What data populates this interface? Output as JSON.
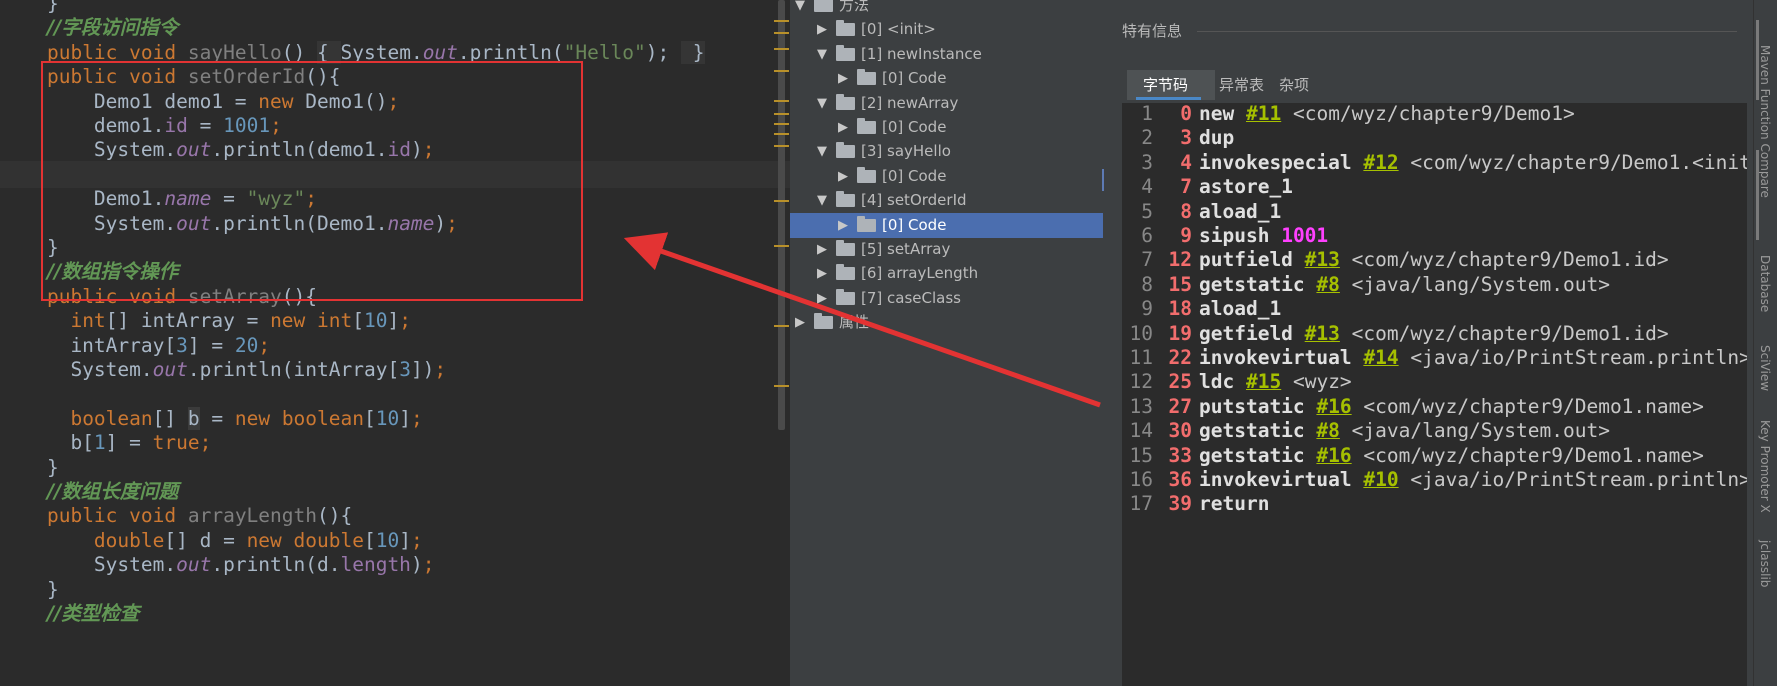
{
  "editor": {
    "lines": [
      {
        "segs": [
          {
            "t": "    }",
            "c": ""
          }
        ]
      },
      {
        "segs": [
          {
            "t": "    ",
            "c": ""
          },
          {
            "t": "//字段访问指令",
            "c": "cm"
          }
        ]
      },
      {
        "segs": [
          {
            "t": "    ",
            "c": ""
          },
          {
            "t": "public void ",
            "c": "k"
          },
          {
            "t": "sayHello",
            "c": "mg"
          },
          {
            "t": "() ",
            "c": ""
          },
          {
            "t": "{ ",
            "c": "fold"
          },
          {
            "t": "System.",
            "c": ""
          },
          {
            "t": "out",
            "c": "fd it"
          },
          {
            "t": ".println(",
            "c": ""
          },
          {
            "t": "\"Hello\"",
            "c": "st"
          },
          {
            "t": "); ",
            "c": ""
          },
          {
            "t": " }",
            "c": "fold"
          }
        ]
      },
      {
        "segs": [
          {
            "t": "    ",
            "c": ""
          },
          {
            "t": "public void ",
            "c": "k"
          },
          {
            "t": "setOrderId",
            "c": "mg"
          },
          {
            "t": "(){",
            "c": ""
          }
        ]
      },
      {
        "segs": [
          {
            "t": "        Demo1 demo1 = ",
            "c": ""
          },
          {
            "t": "new ",
            "c": "k"
          },
          {
            "t": "Demo1()",
            "c": ""
          },
          {
            "t": ";",
            "c": "k"
          }
        ]
      },
      {
        "segs": [
          {
            "t": "        demo1.",
            "c": ""
          },
          {
            "t": "id",
            "c": "fd"
          },
          {
            "t": " = ",
            "c": ""
          },
          {
            "t": "1001",
            "c": "nm"
          },
          {
            "t": ";",
            "c": "k"
          }
        ]
      },
      {
        "segs": [
          {
            "t": "        System.",
            "c": ""
          },
          {
            "t": "out",
            "c": "fd it"
          },
          {
            "t": ".println(demo1.",
            "c": ""
          },
          {
            "t": "id",
            "c": "fd"
          },
          {
            "t": ")",
            "c": ""
          },
          {
            "t": ";",
            "c": "k"
          }
        ]
      },
      {
        "segs": [
          {
            "t": "",
            "c": ""
          }
        ],
        "hl": true
      },
      {
        "segs": [
          {
            "t": "        Demo1.",
            "c": ""
          },
          {
            "t": "name",
            "c": "fd it"
          },
          {
            "t": " = ",
            "c": ""
          },
          {
            "t": "\"wyz\"",
            "c": "st"
          },
          {
            "t": ";",
            "c": "k"
          }
        ]
      },
      {
        "segs": [
          {
            "t": "        System.",
            "c": ""
          },
          {
            "t": "out",
            "c": "fd it"
          },
          {
            "t": ".println(Demo1.",
            "c": ""
          },
          {
            "t": "name",
            "c": "fd it"
          },
          {
            "t": ")",
            "c": ""
          },
          {
            "t": ";",
            "c": "k"
          }
        ]
      },
      {
        "segs": [
          {
            "t": "    }",
            "c": ""
          }
        ]
      },
      {
        "segs": [
          {
            "t": "    ",
            "c": ""
          },
          {
            "t": "//数组指令操作",
            "c": "cm"
          }
        ]
      },
      {
        "segs": [
          {
            "t": "    ",
            "c": ""
          },
          {
            "t": "public void ",
            "c": "k"
          },
          {
            "t": "setArray",
            "c": "mg"
          },
          {
            "t": "(){",
            "c": ""
          }
        ]
      },
      {
        "segs": [
          {
            "t": "      ",
            "c": ""
          },
          {
            "t": "int",
            "c": "k"
          },
          {
            "t": "[] intArray = ",
            "c": ""
          },
          {
            "t": "new int",
            "c": "k"
          },
          {
            "t": "[",
            "c": ""
          },
          {
            "t": "10",
            "c": "nm"
          },
          {
            "t": "]",
            "c": ""
          },
          {
            "t": ";",
            "c": "k"
          }
        ]
      },
      {
        "segs": [
          {
            "t": "      intArray[",
            "c": ""
          },
          {
            "t": "3",
            "c": "nm"
          },
          {
            "t": "] = ",
            "c": ""
          },
          {
            "t": "20",
            "c": "nm"
          },
          {
            "t": ";",
            "c": "k"
          }
        ]
      },
      {
        "segs": [
          {
            "t": "      System.",
            "c": ""
          },
          {
            "t": "out",
            "c": "fd it"
          },
          {
            "t": ".println(intArray[",
            "c": ""
          },
          {
            "t": "3",
            "c": "nm"
          },
          {
            "t": "])",
            "c": ""
          },
          {
            "t": ";",
            "c": "k"
          }
        ]
      },
      {
        "segs": [
          {
            "t": "",
            "c": ""
          }
        ]
      },
      {
        "segs": [
          {
            "t": "      ",
            "c": ""
          },
          {
            "t": "boolean",
            "c": "k"
          },
          {
            "t": "[] ",
            "c": ""
          },
          {
            "t": "b",
            "c": "var"
          },
          {
            "t": " = ",
            "c": ""
          },
          {
            "t": "new boolean",
            "c": "k"
          },
          {
            "t": "[",
            "c": ""
          },
          {
            "t": "10",
            "c": "nm"
          },
          {
            "t": "]",
            "c": ""
          },
          {
            "t": ";",
            "c": "k"
          }
        ]
      },
      {
        "segs": [
          {
            "t": "      b[",
            "c": ""
          },
          {
            "t": "1",
            "c": "nm"
          },
          {
            "t": "] = ",
            "c": ""
          },
          {
            "t": "true",
            "c": "k"
          },
          {
            "t": ";",
            "c": "k"
          }
        ]
      },
      {
        "segs": [
          {
            "t": "    }",
            "c": ""
          }
        ]
      },
      {
        "segs": [
          {
            "t": "    ",
            "c": ""
          },
          {
            "t": "//数组长度问题",
            "c": "cm"
          }
        ]
      },
      {
        "segs": [
          {
            "t": "    ",
            "c": ""
          },
          {
            "t": "public void ",
            "c": "k"
          },
          {
            "t": "arrayLength",
            "c": "mg"
          },
          {
            "t": "(){",
            "c": ""
          }
        ]
      },
      {
        "segs": [
          {
            "t": "        ",
            "c": ""
          },
          {
            "t": "double",
            "c": "k"
          },
          {
            "t": "[] d = ",
            "c": ""
          },
          {
            "t": "new double",
            "c": "k"
          },
          {
            "t": "[",
            "c": ""
          },
          {
            "t": "10",
            "c": "nm"
          },
          {
            "t": "]",
            "c": ""
          },
          {
            "t": ";",
            "c": "k"
          }
        ]
      },
      {
        "segs": [
          {
            "t": "        System.",
            "c": ""
          },
          {
            "t": "out",
            "c": "fd it"
          },
          {
            "t": ".println(d.",
            "c": ""
          },
          {
            "t": "length",
            "c": "fd"
          },
          {
            "t": ")",
            "c": ""
          },
          {
            "t": ";",
            "c": "k"
          }
        ]
      },
      {
        "segs": [
          {
            "t": "    }",
            "c": ""
          }
        ]
      },
      {
        "segs": [
          {
            "t": "    ",
            "c": ""
          },
          {
            "t": "//类型检查",
            "c": "cm"
          }
        ]
      }
    ]
  },
  "tree": {
    "items": [
      {
        "label": "方法",
        "level": 0,
        "expanded": true
      },
      {
        "label": "[0] <init>",
        "level": 1,
        "expanded": false
      },
      {
        "label": "[1] newInstance",
        "level": 1,
        "expanded": true
      },
      {
        "label": "[0] Code",
        "level": 2,
        "expanded": false
      },
      {
        "label": "[2] newArray",
        "level": 1,
        "expanded": true
      },
      {
        "label": "[0] Code",
        "level": 2,
        "expanded": false
      },
      {
        "label": "[3] sayHello",
        "level": 1,
        "expanded": true
      },
      {
        "label": "[0] Code",
        "level": 2,
        "expanded": false
      },
      {
        "label": "[4] setOrderId",
        "level": 1,
        "expanded": true
      },
      {
        "label": "[0] Code",
        "level": 2,
        "expanded": false,
        "selected": true
      },
      {
        "label": "[5] setArray",
        "level": 1,
        "expanded": false
      },
      {
        "label": "[6] arrayLength",
        "level": 1,
        "expanded": false
      },
      {
        "label": "[7] caseClass",
        "level": 1,
        "expanded": false
      },
      {
        "label": "属性",
        "level": 0,
        "expanded": false
      }
    ]
  },
  "panel": {
    "title": "特有信息",
    "tabs": [
      "字节码",
      "异常表",
      "杂项"
    ],
    "active_tab": 0,
    "bytecode": [
      {
        "n": "1",
        "off": "0",
        "op": "new",
        "ref": "#11",
        "target": "<com/wyz/chapter9/Demo1>"
      },
      {
        "n": "2",
        "off": "3",
        "op": "dup"
      },
      {
        "n": "3",
        "off": "4",
        "op": "invokespecial",
        "ref": "#12",
        "target": "<com/wyz/chapter9/Demo1.<init"
      },
      {
        "n": "4",
        "off": "7",
        "op": "astore_1"
      },
      {
        "n": "5",
        "off": "8",
        "op": "aload_1"
      },
      {
        "n": "6",
        "off": "9",
        "op": "sipush",
        "val": "1001"
      },
      {
        "n": "7",
        "off": "12",
        "op": "putfield",
        "ref": "#13",
        "target": "<com/wyz/chapter9/Demo1.id>"
      },
      {
        "n": "8",
        "off": "15",
        "op": "getstatic",
        "ref": "#8",
        "target": "<java/lang/System.out>"
      },
      {
        "n": "9",
        "off": "18",
        "op": "aload_1"
      },
      {
        "n": "10",
        "off": "19",
        "op": "getfield",
        "ref": "#13",
        "target": "<com/wyz/chapter9/Demo1.id>"
      },
      {
        "n": "11",
        "off": "22",
        "op": "invokevirtual",
        "ref": "#14",
        "target": "<java/io/PrintStream.println>"
      },
      {
        "n": "12",
        "off": "25",
        "op": "ldc",
        "ref": "#15",
        "target": "<wyz>"
      },
      {
        "n": "13",
        "off": "27",
        "op": "putstatic",
        "ref": "#16",
        "target": "<com/wyz/chapter9/Demo1.name>"
      },
      {
        "n": "14",
        "off": "30",
        "op": "getstatic",
        "ref": "#8",
        "target": "<java/lang/System.out>"
      },
      {
        "n": "15",
        "off": "33",
        "op": "getstatic",
        "ref": "#16",
        "target": "<com/wyz/chapter9/Demo1.name>"
      },
      {
        "n": "16",
        "off": "36",
        "op": "invokevirtual",
        "ref": "#10",
        "target": "<java/io/PrintStream.println>"
      },
      {
        "n": "17",
        "off": "39",
        "op": "return"
      }
    ]
  },
  "sidebar": {
    "labels": [
      "Maven Function Compare",
      "Database",
      "SciView",
      "Key Promoter X",
      "jclasslib"
    ]
  },
  "colors": {
    "annotation_red": "#e33333",
    "selection_blue": "#4b6eaf",
    "ref_green": "#a6c000",
    "offset_red": "#f26d6d",
    "number_magenta": "#ff40ff"
  }
}
